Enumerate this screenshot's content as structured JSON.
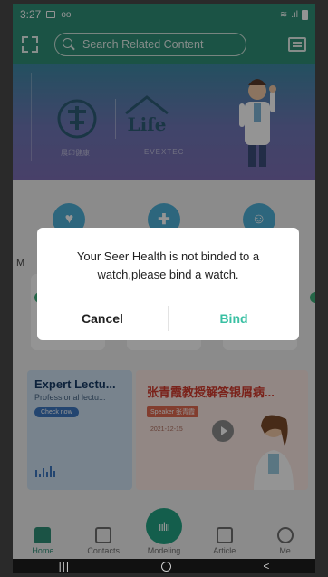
{
  "status_bar": {
    "time": "3:27",
    "left_icons": [
      "image-icon",
      "voicemail-icon"
    ],
    "right_icons": [
      "wifi-icon",
      "lte-signal-icon",
      "battery-icon"
    ]
  },
  "header": {
    "search_placeholder": "Search Related Content",
    "left_icon": "scan-icon",
    "right_icon": "message-icon"
  },
  "banner": {
    "logo_text": "Life",
    "caption_cn": "晨印健康",
    "caption_en": "EVEXTEC",
    "colors": {
      "top": "#3e8aa6",
      "bottom": "#7c6fb5"
    }
  },
  "content": {
    "section_label": "M",
    "lecture": {
      "title": "Expert Lectu...",
      "description": "Professional lectu...",
      "button": "Check now"
    },
    "promo": {
      "title": "张青霞教授解答银屑病...",
      "speaker": "Speaker 张青霞",
      "date": "2021-12-15"
    }
  },
  "dialog": {
    "message": "Your Seer Health is not binded to a watch,please bind a watch.",
    "cancel_label": "Cancel",
    "bind_label": "Bind",
    "accent_color": "#39c0a3"
  },
  "bottom_nav": {
    "items": [
      {
        "label": "Home",
        "icon": "home-icon",
        "active": true
      },
      {
        "label": "Contacts",
        "icon": "contacts-icon",
        "active": false
      },
      {
        "label": "Modeling",
        "icon": "waveform-icon",
        "active": false
      },
      {
        "label": "Article",
        "icon": "article-icon",
        "active": false
      },
      {
        "label": "Me",
        "icon": "profile-icon",
        "active": false
      }
    ]
  },
  "system_nav": {
    "recent": "|||",
    "back": "<"
  },
  "theme": {
    "primary": "#2f8f78"
  }
}
